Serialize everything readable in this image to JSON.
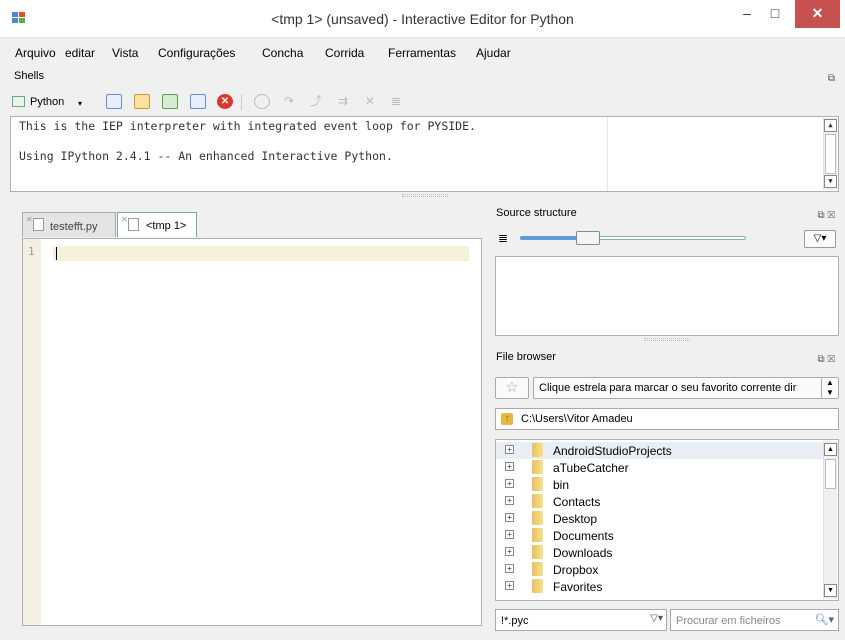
{
  "window": {
    "title": "<tmp 1> (unsaved) - Interactive Editor for Python",
    "min_glyph": "–",
    "max_glyph": "□",
    "close_glyph": "✕"
  },
  "menu": [
    "Arquivo",
    "editar",
    "Vista",
    "Configurações",
    "Concha",
    "Corrida",
    "Ferramentas",
    "Ajudar"
  ],
  "shells_panel": {
    "title": "Shells",
    "shell_button": "Python",
    "lines": [
      "This is the IEP interpreter with integrated event loop for PYSIDE.",
      "Using IPython 2.4.1 -- An enhanced Interactive Python."
    ]
  },
  "editor": {
    "tabs": [
      {
        "label": "testefft.py",
        "active": false
      },
      {
        "label": "<tmp 1>",
        "active": true
      }
    ],
    "line_numbers": [
      "1"
    ]
  },
  "source_structure": {
    "title": "Source structure",
    "slider_fraction": 0.3
  },
  "file_browser": {
    "title": "File browser",
    "star_glyph": "☆",
    "favorites_placeholder": "Clique estrela para marcar o seu favorito corrente dir",
    "path": "C:\\Users\\Vitor Amadeu",
    "items": [
      "AndroidStudioProjects",
      "aTubeCatcher",
      "bin",
      "Contacts",
      "Desktop",
      "Documents",
      "Downloads",
      "Dropbox",
      "Favorites"
    ],
    "filter": "!*.pyc",
    "search_placeholder": "Procurar em ficheiros"
  },
  "colors": {
    "titlebar_close": "#c75050",
    "editor_gutter": "#f3f0e2",
    "current_line": "#f5f2dc",
    "folder": "#e8c060"
  }
}
